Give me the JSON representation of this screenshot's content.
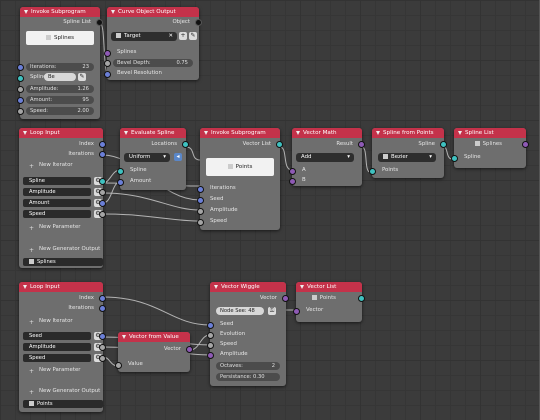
{
  "invoke1": {
    "title": "Invoke Subprogram",
    "out_spline_list": "Spline List",
    "card": "Splines",
    "iterations_label": "Iterations:",
    "iterations": "23",
    "spline_label": "Spline",
    "spline_value": "Be",
    "amplitude_label": "Amplitude:",
    "amplitude": "1.26",
    "amount_label": "Amount:",
    "amount": "95",
    "speed_label": "Speed:",
    "speed": "2.00"
  },
  "curve": {
    "title": "Curve Object Output",
    "out_object": "Object",
    "target": "Target",
    "splines": "Splines",
    "bevel_depth_label": "Bevel Depth:",
    "bevel_depth": "0.75",
    "bevel_resolution": "Bevel Resolution"
  },
  "loop1": {
    "title": "Loop Input",
    "out_index": "Index",
    "out_iterations": "Iterations",
    "new_iterator": "New Iterator",
    "params": [
      "Spline",
      "Amplitude",
      "Amount",
      "Speed"
    ],
    "new_parameter": "New Parameter",
    "new_generator": "New Generator Output",
    "generator": "Splines"
  },
  "eval": {
    "title": "Evaluate Spline",
    "out_locations": "Locations",
    "mode": "Uniform",
    "in_spline": "Spline",
    "in_amount": "Amount"
  },
  "invoke2": {
    "title": "Invoke Subprogram",
    "out_vector_list": "Vector List",
    "card": "Points",
    "inputs": [
      "Iterations",
      "Seed",
      "Amplitude",
      "Speed"
    ]
  },
  "vmath": {
    "title": "Vector Math",
    "out_result": "Result",
    "op": "Add",
    "in_a": "A",
    "in_b": "B"
  },
  "sfp": {
    "title": "Spline from Points",
    "out_spline": "Spline",
    "type": "Bezier",
    "in_points": "Points"
  },
  "slist": {
    "title": "Spline List",
    "out_splines": "Splines",
    "in_spline": "Spline"
  },
  "loop2": {
    "title": "Loop Input",
    "out_index": "Index",
    "out_iterations": "Iterations",
    "new_iterator": "New Iterator",
    "params": [
      "Seed",
      "Amplitude",
      "Speed"
    ],
    "new_parameter": "New Parameter",
    "new_generator": "New Generator Output",
    "generator": "Points"
  },
  "vfv": {
    "title": "Vector from Value",
    "out_vector": "Vector",
    "in_value": "Value"
  },
  "wiggle": {
    "title": "Vector Wiggle",
    "out_vector": "Vector",
    "node_seed": "Node See: 48",
    "inputs": [
      "Seed",
      "Evolution",
      "Speed",
      "Amplitude"
    ],
    "octaves_label": "Octaves:",
    "octaves": "2",
    "persistance_label": "Persistance: 0.30"
  },
  "vlist": {
    "title": "Vector List",
    "out_points": "Points",
    "in_vector": "Vector"
  }
}
